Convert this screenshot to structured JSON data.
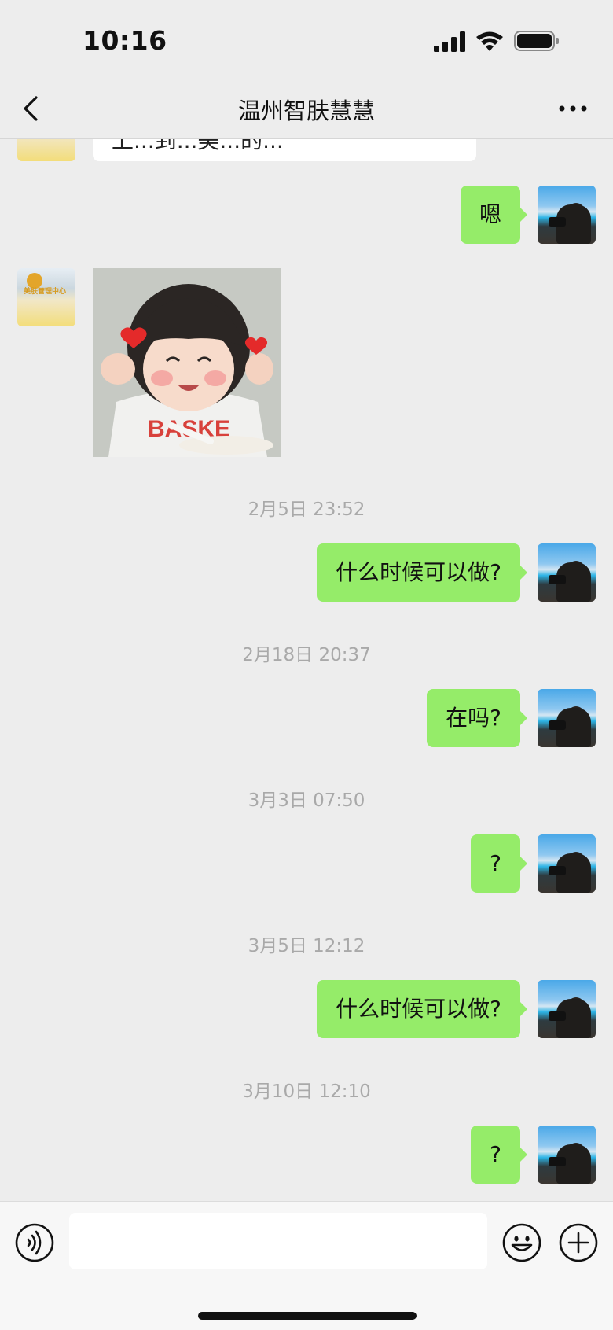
{
  "status_bar": {
    "time": "10:16",
    "signal_icon": "cellular-signal-icon",
    "wifi_icon": "wifi-icon",
    "battery_icon": "battery-icon"
  },
  "nav": {
    "back_icon": "chevron-left-icon",
    "title": "温州智肤慧慧",
    "more_icon": "more-dots-icon"
  },
  "chat": {
    "partial_text": "上...到...美...的...",
    "messages": [
      {
        "type": "text",
        "side": "right",
        "text": "嗯"
      },
      {
        "type": "sticker",
        "side": "left",
        "text": "BASKE"
      },
      {
        "type": "time",
        "text": "2月5日 23:52"
      },
      {
        "type": "text",
        "side": "right",
        "text": "什么时候可以做?"
      },
      {
        "type": "time",
        "text": "2月18日 20:37"
      },
      {
        "type": "text",
        "side": "right",
        "text": "在吗?"
      },
      {
        "type": "time",
        "text": "3月3日 07:50"
      },
      {
        "type": "text",
        "side": "right",
        "text": "?"
      },
      {
        "type": "time",
        "text": "3月5日 12:12"
      },
      {
        "type": "text",
        "side": "right",
        "text": "什么时候可以做?"
      },
      {
        "type": "time",
        "text": "3月10日 12:10"
      },
      {
        "type": "text",
        "side": "right",
        "text": "?"
      }
    ],
    "contact_logo_text": "美肤管理中心"
  },
  "input_bar": {
    "voice_icon": "voice-input-icon",
    "input_value": "",
    "emoji_icon": "emoji-icon",
    "plus_icon": "plus-circle-icon"
  },
  "colors": {
    "background": "#ededed",
    "bubble_right": "#95ec69",
    "bubble_left": "#ffffff",
    "time_text": "#a9a9a9"
  }
}
